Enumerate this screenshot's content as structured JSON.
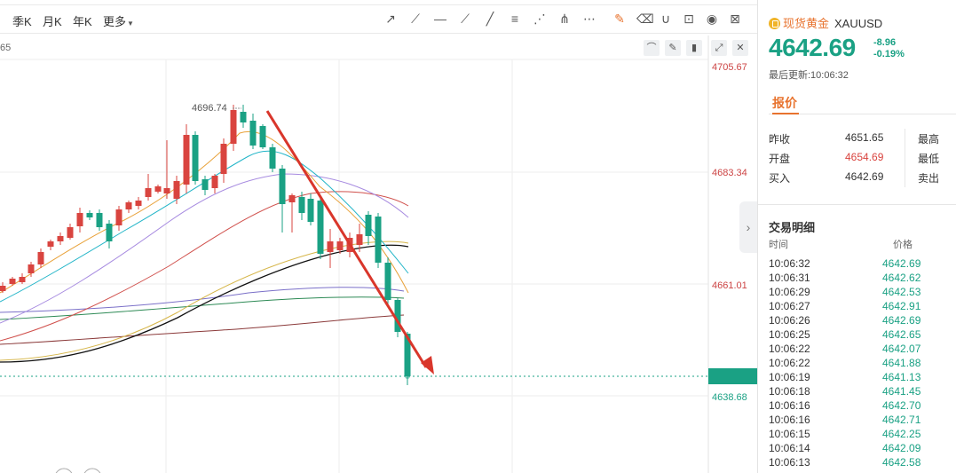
{
  "toolbar": {
    "periods": [
      {
        "label": "季K"
      },
      {
        "label": "月K"
      },
      {
        "label": "年K"
      },
      {
        "label": "更多"
      }
    ],
    "tools": [
      "trend-line",
      "ray-line",
      "horizontal-line",
      "parallel-channel",
      "segment-line",
      "fibonacci",
      "gann-fan",
      "pitchfork",
      "more",
      "draw",
      "eraser",
      "magnet",
      "lock",
      "visibility",
      "delete"
    ]
  },
  "ma_label": "65",
  "price_axis": {
    "labels": [
      "4705.67",
      "4683.34",
      "4661.01",
      "4638.68"
    ]
  },
  "annotations": {
    "high_marker": "4696.74"
  },
  "header": {
    "name": "现货黄金",
    "code": "XAUUSD",
    "price": "4642.69",
    "change": "-8.96",
    "change_pct": "-0.19%",
    "update_label": "最后更新:10:06:32"
  },
  "quote": {
    "tab": "报价",
    "rows": [
      {
        "label": "昨收",
        "value": "4651.65",
        "label2": "最高"
      },
      {
        "label": "开盘",
        "value": "4654.69",
        "label2": "最低"
      },
      {
        "label": "买入",
        "value": "4642.69",
        "label2": "卖出"
      }
    ]
  },
  "trades": {
    "title": "交易明细",
    "col_time": "时间",
    "col_price": "价格",
    "rows": [
      {
        "time": "10:06:32",
        "price": "4642.69"
      },
      {
        "time": "10:06:31",
        "price": "4642.62"
      },
      {
        "time": "10:06:29",
        "price": "4642.53"
      },
      {
        "time": "10:06:27",
        "price": "4642.91"
      },
      {
        "time": "10:06:26",
        "price": "4642.69"
      },
      {
        "time": "10:06:25",
        "price": "4642.65"
      },
      {
        "time": "10:06:22",
        "price": "4642.07"
      },
      {
        "time": "10:06:22",
        "price": "4641.88"
      },
      {
        "time": "10:06:19",
        "price": "4641.13"
      },
      {
        "time": "10:06:18",
        "price": "4641.45"
      },
      {
        "time": "10:06:16",
        "price": "4642.70"
      },
      {
        "time": "10:06:16",
        "price": "4642.71"
      },
      {
        "time": "10:06:15",
        "price": "4642.25"
      },
      {
        "time": "10:06:14",
        "price": "4642.09"
      },
      {
        "time": "10:06:13",
        "price": "4642.58"
      }
    ]
  },
  "colors": {
    "up": "#d9443f",
    "down": "#1aa184",
    "accent": "#e8732e"
  }
}
